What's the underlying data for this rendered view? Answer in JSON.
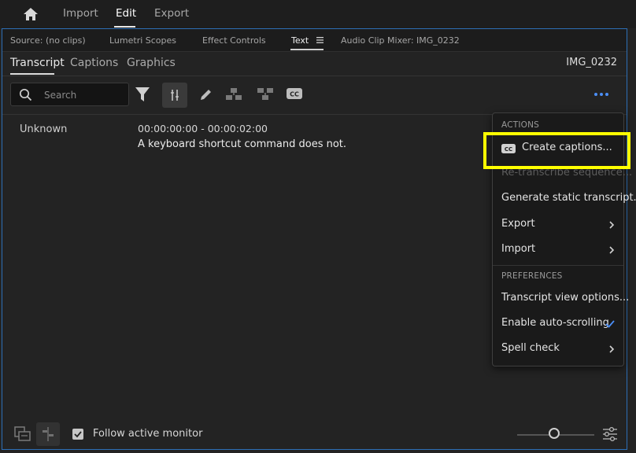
{
  "workspace": {
    "tabs": [
      {
        "label": "Import",
        "active": false
      },
      {
        "label": "Edit",
        "active": true
      },
      {
        "label": "Export",
        "active": false
      }
    ]
  },
  "panel": {
    "tabs": [
      {
        "label": "Source: (no clips)",
        "active": false
      },
      {
        "label": "Lumetri Scopes",
        "active": false
      },
      {
        "label": "Effect Controls",
        "active": false
      },
      {
        "label": "Text",
        "active": true
      },
      {
        "label": "Audio Clip Mixer: IMG_0232",
        "active": false
      }
    ]
  },
  "text_panel": {
    "tabs": [
      {
        "label": "Transcript",
        "active": true
      },
      {
        "label": "Captions",
        "active": false
      },
      {
        "label": "Graphics",
        "active": false
      }
    ],
    "clip_name": "IMG_0232"
  },
  "toolbar": {
    "search_placeholder": "Search",
    "icons": [
      "filter-icon",
      "split-segment-icon",
      "edit-pencil-icon",
      "merge-segments-icon",
      "split-segments-icon",
      "closed-captions-icon",
      "more-options-icon"
    ]
  },
  "transcript": {
    "rows": [
      {
        "speaker": "Unknown",
        "timecode": "00:00:00:00 - 00:00:02:00",
        "text": "A keyboard shortcut command does not."
      }
    ]
  },
  "menu": {
    "actions_header": "ACTIONS",
    "preferences_header": "PREFERENCES",
    "items": [
      {
        "label": "Create captions...",
        "enabled": true,
        "icon": "cc-icon"
      },
      {
        "label": "Re-transcribe sequence...",
        "enabled": false
      },
      {
        "label": "Generate static transcript...",
        "enabled": true
      },
      {
        "label": "Export",
        "enabled": true,
        "submenu": true
      },
      {
        "label": "Import",
        "enabled": true,
        "submenu": true
      },
      {
        "label": "Transcript view options...",
        "enabled": true
      },
      {
        "label": "Enable auto-scrolling",
        "enabled": true,
        "checked": true
      },
      {
        "label": "Spell check",
        "enabled": true,
        "submenu": true
      }
    ]
  },
  "bottom": {
    "follow_monitor_label": "Follow active monitor",
    "follow_monitor_checked": true
  },
  "colors": {
    "accent": "#2d6fb6",
    "highlight": "#ffff00",
    "check": "#4b8ef7"
  }
}
